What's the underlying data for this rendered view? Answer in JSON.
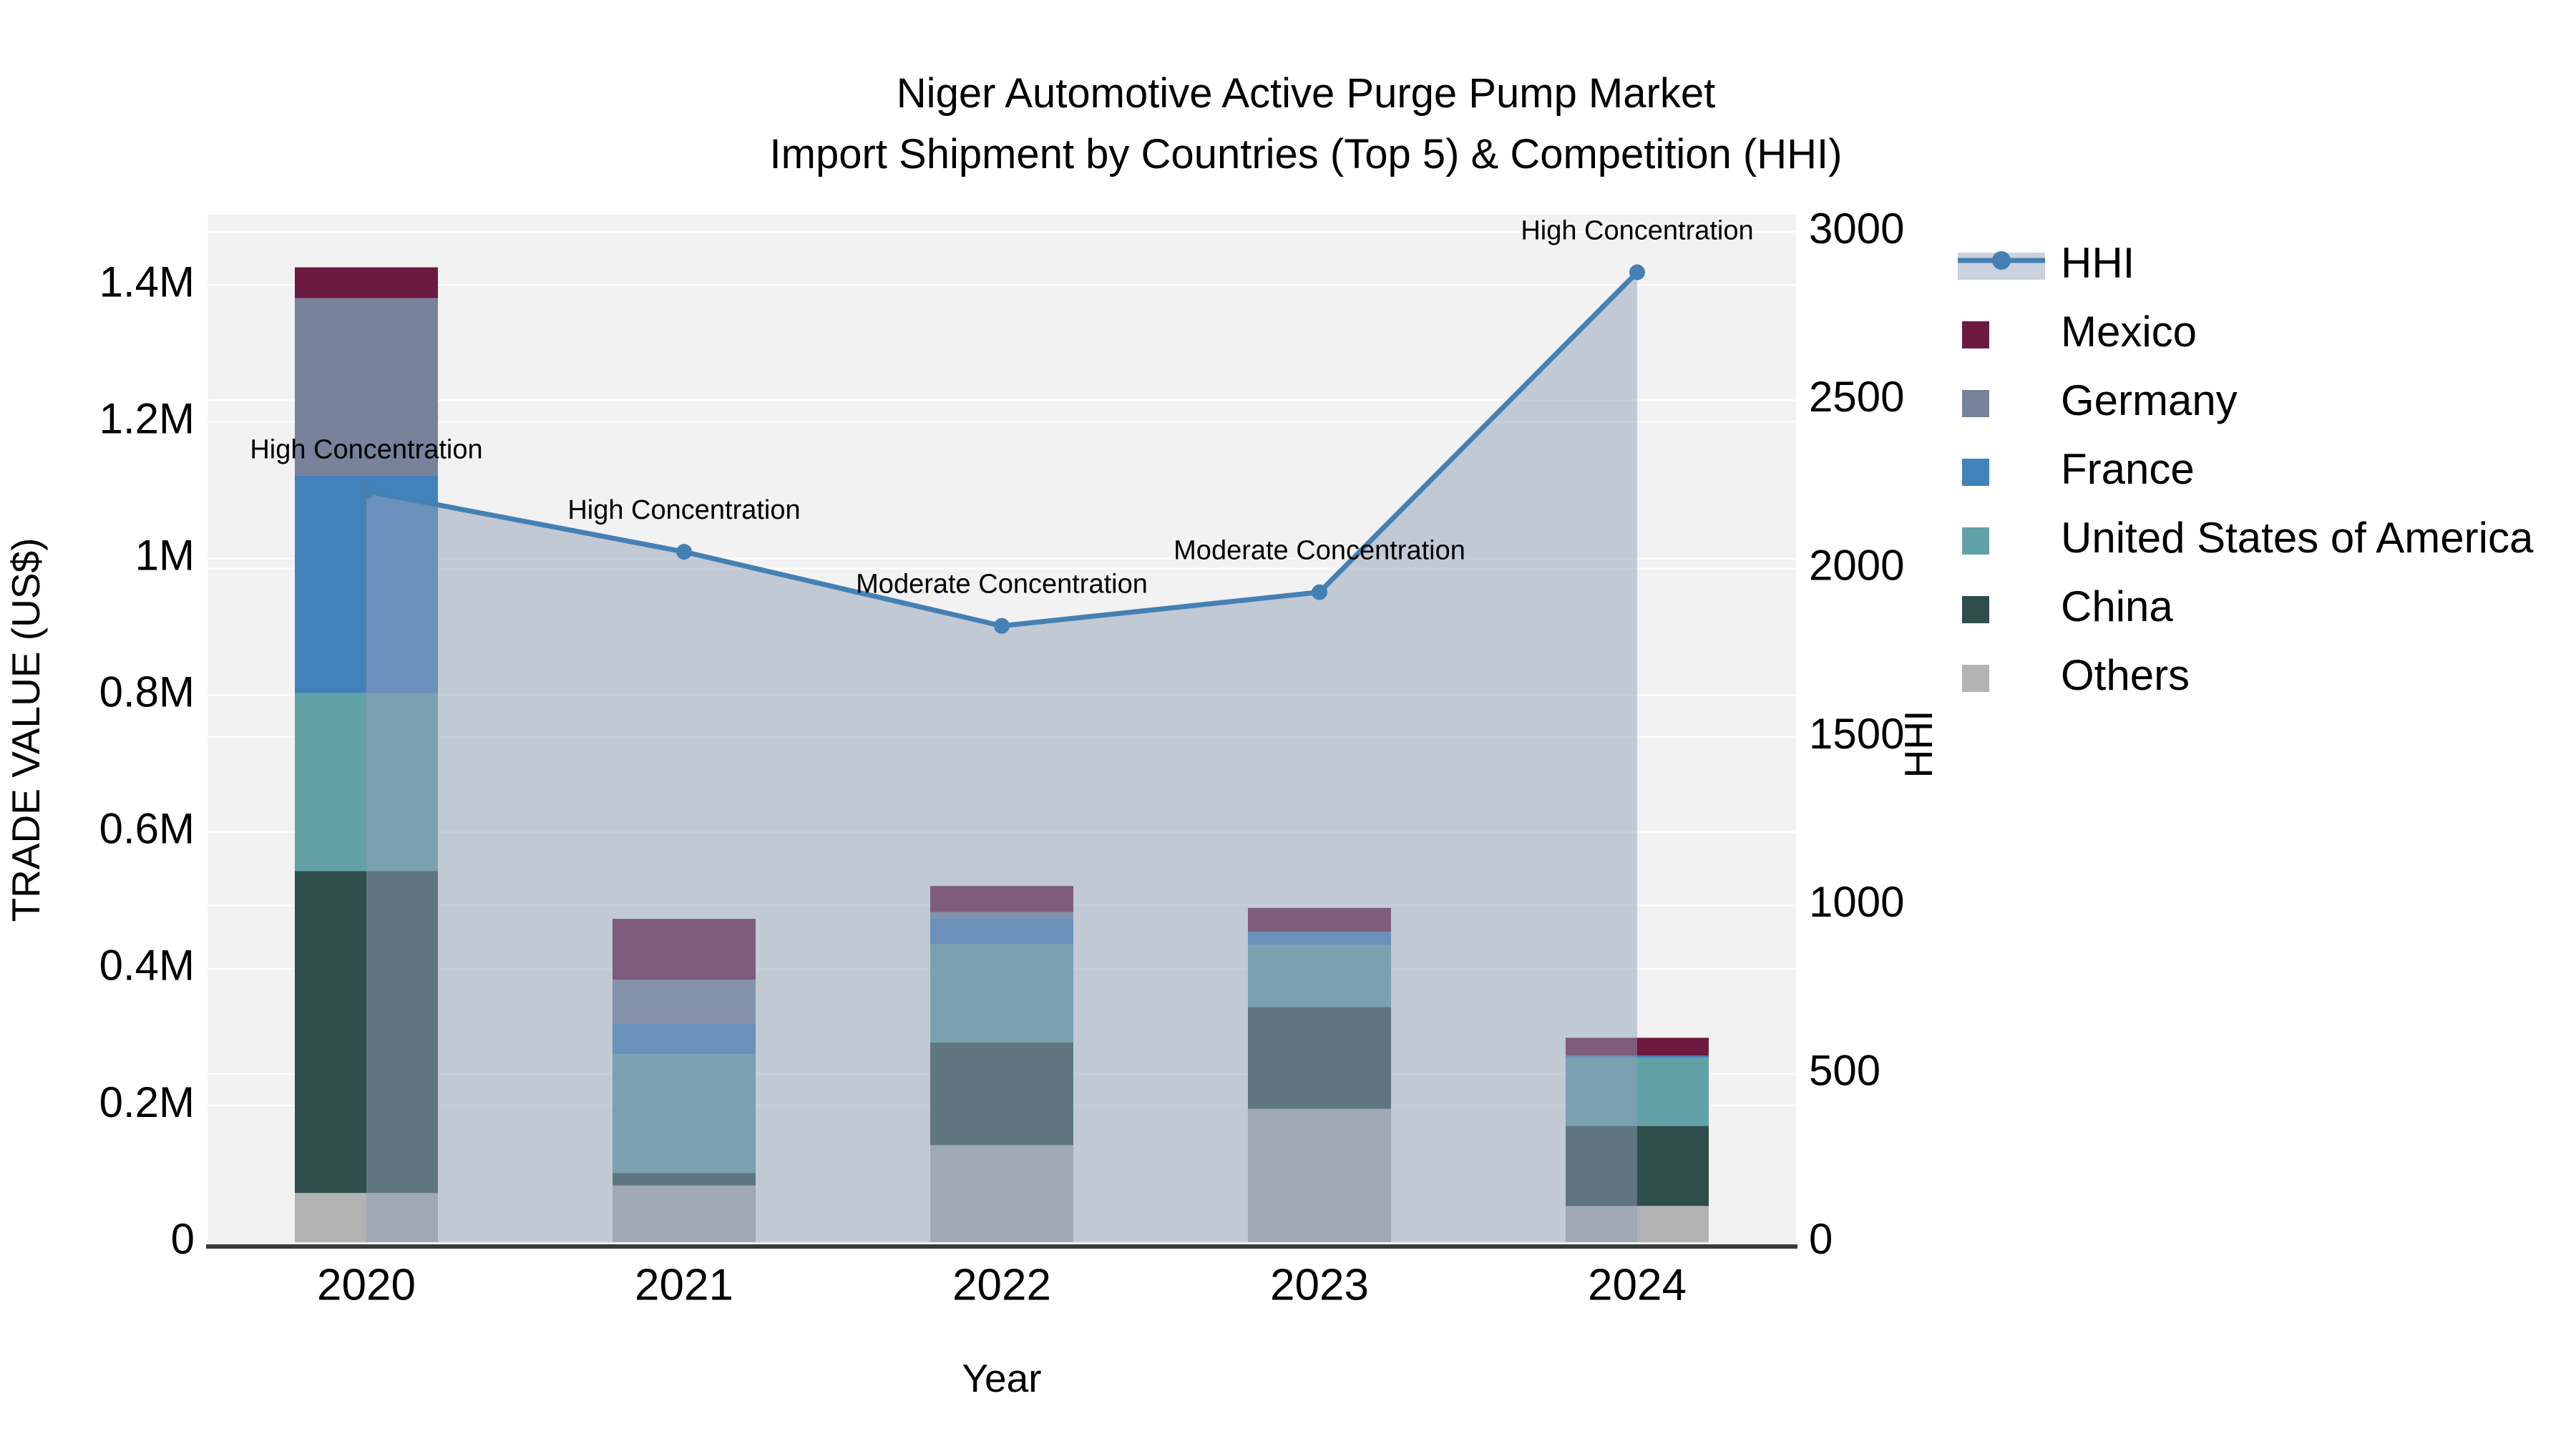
{
  "chart_data": {
    "type": "combo-stacked-bar-line",
    "title": "Niger Automotive Active Purge Pump Market",
    "subtitle": "Import Shipment by Countries (Top 5) & Competition (HHI)",
    "x_axis": {
      "title": "Year",
      "categories": [
        "2020",
        "2021",
        "2022",
        "2023",
        "2024"
      ]
    },
    "y_left_axis": {
      "title": "TRADE VALUE (US$)",
      "units": "millions of US$",
      "tick_labels": [
        "0",
        "0.2M",
        "0.4M",
        "0.6M",
        "0.8M",
        "1M",
        "1.2M",
        "1.4M"
      ],
      "tick_values": [
        0,
        0.2,
        0.4,
        0.6,
        0.8,
        1.0,
        1.2,
        1.4
      ],
      "range": [
        0,
        1.503
      ],
      "grid": true
    },
    "y_right_axis": {
      "title": "HHI",
      "tick_labels": [
        "0",
        "500",
        "1000",
        "1500",
        "2000",
        "2500",
        "3000"
      ],
      "tick_values": [
        0,
        500,
        1000,
        1500,
        2000,
        2500,
        3000
      ],
      "range": [
        0,
        3051
      ],
      "grid": true
    },
    "bar_series_stack_bottom_to_top": [
      {
        "name": "Others",
        "color": "#b3b3b3",
        "values": [
          0.072,
          0.083,
          0.142,
          0.195,
          0.053
        ]
      },
      {
        "name": "China",
        "color": "#2f4d4a",
        "values": [
          0.471,
          0.018,
          0.15,
          0.149,
          0.117
        ]
      },
      {
        "name": "United States of America",
        "color": "#62a2a6",
        "values": [
          0.26,
          0.174,
          0.144,
          0.091,
          0.1
        ]
      },
      {
        "name": "France",
        "color": "#4282ba",
        "values": [
          0.318,
          0.045,
          0.038,
          0.019,
          0.003
        ]
      },
      {
        "name": "Germany",
        "color": "#76839a",
        "values": [
          0.26,
          0.064,
          0.009,
          0.0,
          0.0
        ]
      },
      {
        "name": "Mexico",
        "color": "#6d1a41",
        "values": [
          0.045,
          0.089,
          0.038,
          0.035,
          0.026
        ]
      }
    ],
    "line_series": {
      "name": "HHI",
      "color": "#4480b3",
      "area_fill": "rgba(144,160,184,0.5)",
      "marker_radius": 11,
      "line_width": 7,
      "values": [
        2230,
        2050,
        1830,
        1930,
        2880
      ]
    },
    "annotations": [
      {
        "x": "2020",
        "text": "High Concentration"
      },
      {
        "x": "2021",
        "text": "High Concentration"
      },
      {
        "x": "2022",
        "text": "Moderate Concentration"
      },
      {
        "x": "2023",
        "text": "Moderate Concentration"
      },
      {
        "x": "2024",
        "text": "High Concentration"
      }
    ],
    "legend": [
      {
        "label": "HHI",
        "swatch": "line-marker",
        "color": "#4480b3",
        "band_color": "#c9d2de"
      },
      {
        "label": "Mexico",
        "swatch": "square",
        "color": "#6d1a41"
      },
      {
        "label": "Germany",
        "swatch": "square",
        "color": "#76839a"
      },
      {
        "label": "France",
        "swatch": "square",
        "color": "#4282ba"
      },
      {
        "label": "United States of America",
        "swatch": "square",
        "color": "#62a2a6"
      },
      {
        "label": "China",
        "swatch": "square",
        "color": "#2f4d4a"
      },
      {
        "label": "Others",
        "swatch": "square",
        "color": "#b3b3b3"
      }
    ],
    "plot_background": "#f2f2f2",
    "gridline_color": "#ffffff",
    "axis_line_color": "#3a3a3a"
  }
}
